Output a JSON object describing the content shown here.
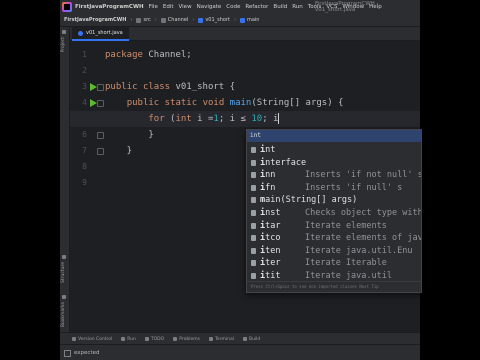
{
  "menu": {
    "project": "FirstJavaProgramCWH",
    "items": [
      "File",
      "Edit",
      "View",
      "Navigate",
      "Code",
      "Refactor",
      "Build",
      "Run",
      "Tools",
      "VCS",
      "Window",
      "Help"
    ],
    "window_title": "FirstJavaProgramCWH - v01_short.java"
  },
  "breadcrumb": [
    "FirstJavaProgramCWH",
    "src",
    "Channel",
    "v01_short",
    "main"
  ],
  "left_stripe": {
    "top": "Project",
    "bottom_1": "Structure",
    "bottom_2": "Bookmarks"
  },
  "tab": {
    "label": "v01_short.java"
  },
  "editor": {
    "current_line": 5,
    "lines": [
      {
        "n": "1",
        "code": "package Channel;"
      },
      {
        "n": "2",
        "code": ""
      },
      {
        "n": "3",
        "code": "public class v01_short {"
      },
      {
        "n": "4",
        "code": "    public static void main(String[] args) {"
      },
      {
        "n": "5",
        "code": "        for (int i =1; i ≤ 10; i"
      },
      {
        "n": "6",
        "code": "        }"
      },
      {
        "n": "7",
        "code": "    }"
      },
      {
        "n": "8",
        "code": ""
      },
      {
        "n": "9",
        "code": ""
      }
    ]
  },
  "completion": {
    "header": "int",
    "items": [
      {
        "name": "int",
        "desc": ""
      },
      {
        "name": "interface",
        "desc": ""
      },
      {
        "name": "inn",
        "desc": "Inserts 'if not null' s"
      },
      {
        "name": "ifn",
        "desc": "Inserts 'if null' s"
      },
      {
        "name": "main(String[] args)",
        "desc": ""
      },
      {
        "name": "inst",
        "desc": "Checks object type with"
      },
      {
        "name": "itar",
        "desc": "Iterate elements"
      },
      {
        "name": "itco",
        "desc": "Iterate elements of java"
      },
      {
        "name": "iten",
        "desc": "Iterate java.util.Enu"
      },
      {
        "name": "iter",
        "desc": "Iterate Iterable"
      },
      {
        "name": "itit",
        "desc": "Iterate java.util"
      }
    ],
    "footer": "Press Ctrl+Space to see non-imported classes  Next Tip"
  },
  "bottom_tools": [
    "Version Control",
    "Run",
    "TODO",
    "Problems",
    "Terminal",
    "Build"
  ],
  "status": {
    "message": "expected"
  }
}
